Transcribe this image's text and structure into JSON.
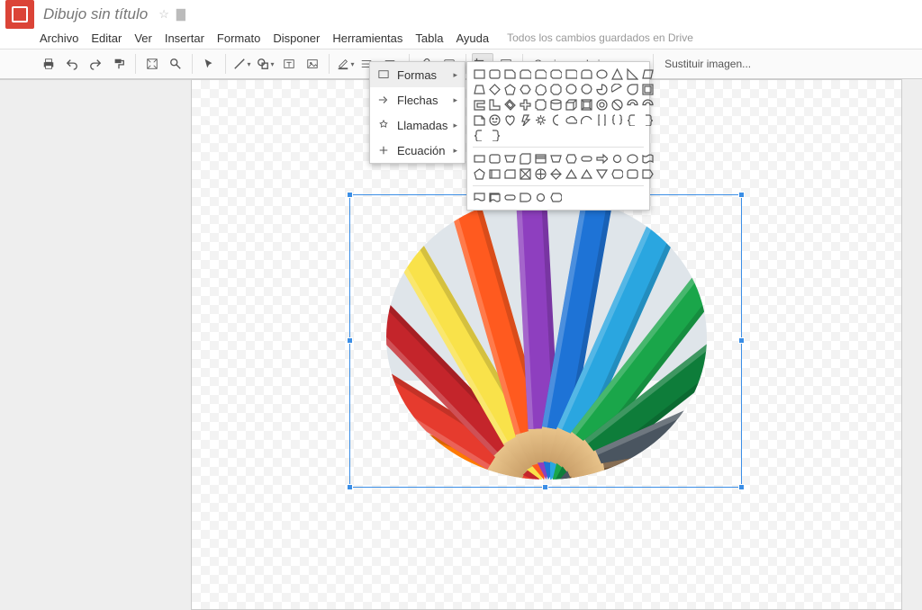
{
  "header": {
    "doc_title": "Dibujo sin título",
    "star_icon": "☆",
    "folder_icon": "📁"
  },
  "menus": {
    "items": [
      "Archivo",
      "Editar",
      "Ver",
      "Insertar",
      "Formato",
      "Disponer",
      "Herramientas",
      "Tabla",
      "Ayuda"
    ],
    "save_status": "Todos los cambios guardados en Drive"
  },
  "toolbar": {
    "image_options": "Opciones de imagen...",
    "replace_image": "Sustituir imagen..."
  },
  "shape_menu": {
    "items": [
      {
        "icon": "rect",
        "label": "Formas"
      },
      {
        "icon": "arrow",
        "label": "Flechas"
      },
      {
        "icon": "callout",
        "label": "Llamadas"
      },
      {
        "icon": "equation",
        "label": "Ecuación"
      }
    ],
    "selected_index": 0
  }
}
